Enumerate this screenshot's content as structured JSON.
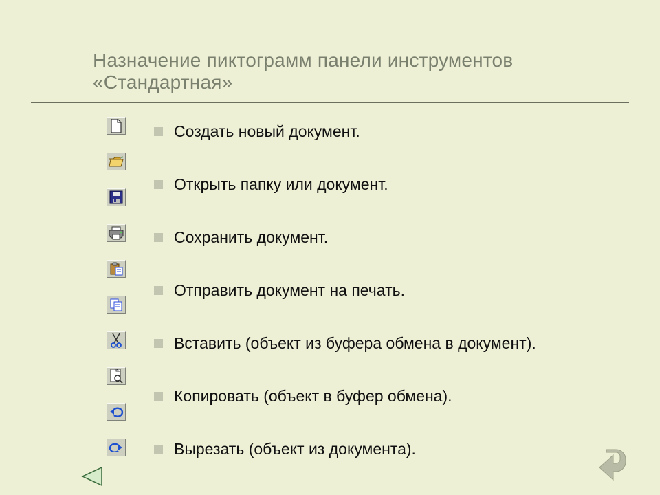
{
  "title": "Назначение пиктограмм панели инструментов «Стандартная»",
  "items": [
    {
      "label": "Создать новый документ.",
      "icon": "new-document-icon"
    },
    {
      "label": "Открыть папку или документ.",
      "icon": "open-folder-icon"
    },
    {
      "label": "Сохранить документ.",
      "icon": "save-icon"
    },
    {
      "label": "Отправить документ на печать.",
      "icon": "print-icon"
    },
    {
      "label": "Вставить (объект из буфера обмена в документ).",
      "icon": "paste-icon"
    },
    {
      "label": "Копировать (объект в буфер обмена).",
      "icon": "copy-icon"
    },
    {
      "label": "Вырезать (объект из документа).",
      "icon": "cut-icon"
    }
  ],
  "additional_icons": [
    "print-preview-icon",
    "undo-icon",
    "redo-icon"
  ],
  "nav": {
    "back": "back",
    "return": "return"
  }
}
